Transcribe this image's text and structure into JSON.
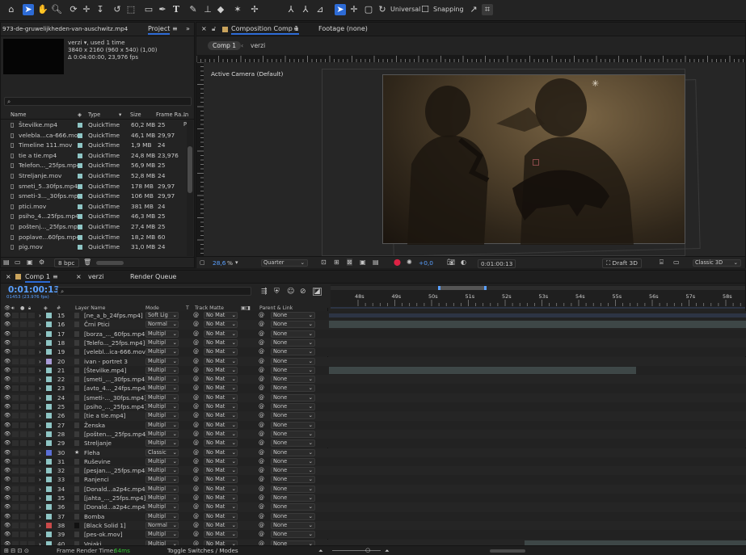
{
  "toolbar": {
    "universal": "Universal",
    "snapping": "Snapping"
  },
  "project": {
    "file_name": "973-de-gruwelijkheden-van-auschwitz.mp4",
    "panel_tab": "Project",
    "item_name": "verzi",
    "item_used": ", used 1 time",
    "item_res": "3840 x 2160  (960 x 540) (1,00)",
    "item_dur": "Δ 0:04:00:00, 23,976 fps",
    "search_placeholder": "",
    "columns": [
      "Name",
      "Type",
      "Size",
      "Frame Ra...",
      "In Po"
    ],
    "rows": [
      {
        "name": "Številke.mp4",
        "type": "QuickTime",
        "size": "60,2 MB",
        "fps": "25"
      },
      {
        "name": "velebla...ca-666.mov",
        "type": "QuickTime",
        "size": "46,1 MB",
        "fps": "29,97"
      },
      {
        "name": "Timeline 111.mov",
        "type": "QuickTime",
        "size": "1,9 MB",
        "fps": "24"
      },
      {
        "name": "tie a tie.mp4",
        "type": "QuickTime",
        "size": "24,8 MB",
        "fps": "23,976"
      },
      {
        "name": "Telefon..._25fps.mp4",
        "type": "QuickTime",
        "size": "56,9 MB",
        "fps": "25"
      },
      {
        "name": "Streljanje.mov",
        "type": "QuickTime",
        "size": "52,8 MB",
        "fps": "24"
      },
      {
        "name": "smeti_5..30fps.mp4",
        "type": "QuickTime",
        "size": "178 MB",
        "fps": "29,97"
      },
      {
        "name": "smeti-3..._30fps.mp4",
        "type": "QuickTime",
        "size": "106 MB",
        "fps": "29,97"
      },
      {
        "name": "ptici.mov",
        "type": "QuickTime",
        "size": "381 MB",
        "fps": "24"
      },
      {
        "name": "psiho_4...25fps.mp4",
        "type": "QuickTime",
        "size": "46,3 MB",
        "fps": "25"
      },
      {
        "name": "poštenj..._25fps.mp4",
        "type": "QuickTime",
        "size": "27,4 MB",
        "fps": "25"
      },
      {
        "name": "poplave...60fps.mp4",
        "type": "QuickTime",
        "size": "18,2 MB",
        "fps": "60"
      },
      {
        "name": "pig.mov",
        "type": "QuickTime",
        "size": "31,0 MB",
        "fps": "24"
      }
    ],
    "bpc": "8 bpc"
  },
  "viewer": {
    "tab_title": "Composition Comp 1",
    "footage": "Footage (none)",
    "comp_tab": "Comp 1",
    "breadcrumb_item": "verzi",
    "camera_label": "Active Camera (Default)",
    "zoom": "28,6",
    "zoom_unit": "%",
    "resolution": "Quarter",
    "exposure": "+0,0",
    "timecode": "0:01:00:13",
    "draft": "Draft 3D",
    "renderer": "Classic 3D"
  },
  "timeline": {
    "tab": "Comp 1",
    "tab2": "verzi",
    "tab3": "Render Queue",
    "timecode": "0:01:00:13",
    "frame_info": "01453 (23.976 fps)",
    "col_layer_name": "Layer Name",
    "col_mode": "Mode",
    "col_t": "T",
    "col_track_matte": "Track Matte",
    "col_parent": "Parent & Link",
    "col_num": "#",
    "ruler_labels": [
      "48s",
      "49s",
      "50s",
      "51s",
      "52s",
      "53s",
      "54s",
      "55s",
      "56s",
      "57s",
      "58s"
    ],
    "matte_label": "No Mat",
    "parent_label": "None",
    "layers": [
      {
        "num": "15",
        "name": "[ne_a_b_24fps.mp4]",
        "mode": "Soft Lig",
        "color": "#8ec5c4",
        "partial": true
      },
      {
        "num": "16",
        "name": "Črni Ptici",
        "mode": "Normal",
        "color": "#8ec5c4"
      },
      {
        "num": "17",
        "name": "[borza_..._60fps.mp4]",
        "mode": "Multipl",
        "color": "#8ec5c4"
      },
      {
        "num": "18",
        "name": "[Telefo..._25fps.mp4]",
        "mode": "Multipl",
        "color": "#8ec5c4"
      },
      {
        "num": "19",
        "name": "[velebl...ica-666.mov]",
        "mode": "Multipl",
        "color": "#8ec5c4"
      },
      {
        "num": "20",
        "name": "ivan - portret 3",
        "mode": "Multipl",
        "color": "#a99bd6"
      },
      {
        "num": "21",
        "name": "[Številke.mp4]",
        "mode": "Multipl",
        "color": "#8ec5c4"
      },
      {
        "num": "22",
        "name": "[smeti_..._30fps.mp4]",
        "mode": "Multipl",
        "color": "#8ec5c4"
      },
      {
        "num": "23",
        "name": "[avto_4..._24fps.mp4]",
        "mode": "Multipl",
        "color": "#8ec5c4"
      },
      {
        "num": "24",
        "name": "[smeti-..._30fps.mp4]",
        "mode": "Multipl",
        "color": "#8ec5c4"
      },
      {
        "num": "25",
        "name": "[psiho_..._25fps.mp4]",
        "mode": "Multipl",
        "color": "#8ec5c4"
      },
      {
        "num": "26",
        "name": "[tie a tie.mp4]",
        "mode": "Multipl",
        "color": "#8ec5c4"
      },
      {
        "num": "27",
        "name": "Ženska",
        "mode": "Multipl",
        "color": "#8ec5c4"
      },
      {
        "num": "28",
        "name": "[pošten..._25fps.mp4]",
        "mode": "Multipl",
        "color": "#8ec5c4"
      },
      {
        "num": "29",
        "name": "Streljanje",
        "mode": "Multipl",
        "color": "#8ec5c4"
      },
      {
        "num": "30",
        "name": "Fleha",
        "mode": "Classic",
        "color": "#5b6fd6",
        "star": true
      },
      {
        "num": "31",
        "name": "Ruševine",
        "mode": "Multipl",
        "color": "#8ec5c4"
      },
      {
        "num": "32",
        "name": "[pesjan..._25fps.mp4]",
        "mode": "Multipl",
        "color": "#8ec5c4"
      },
      {
        "num": "33",
        "name": "Ranjenci",
        "mode": "Multipl",
        "color": "#8ec5c4"
      },
      {
        "num": "34",
        "name": "[Donald...a2p4c.mp4]",
        "mode": "Multipl",
        "color": "#8ec5c4"
      },
      {
        "num": "35",
        "name": "[jahta_..._25fps.mp4]",
        "mode": "Multipl",
        "color": "#8ec5c4"
      },
      {
        "num": "36",
        "name": "[Donald...a2p4c.mp4]",
        "mode": "Multipl",
        "color": "#8ec5c4"
      },
      {
        "num": "37",
        "name": "Bomba",
        "mode": "Multipl",
        "color": "#8ec5c4"
      },
      {
        "num": "38",
        "name": "[Black Solid 1]",
        "mode": "Normal",
        "color": "#c94a4a"
      },
      {
        "num": "39",
        "name": "[pes-ok.mov]",
        "mode": "Multipl",
        "color": "#8ec5c4"
      },
      {
        "num": "40",
        "name": "Vojaki",
        "mode": "Multipl",
        "color": "#8ec5c4"
      }
    ],
    "render_time_label": "Frame Render Time:",
    "render_time_value": "64ms",
    "toggle_label": "Toggle Switches / Modes"
  },
  "colors": {
    "accent": "#2d6bd6",
    "timecode_blue": "#5aa0ff",
    "green": "#31c431"
  }
}
